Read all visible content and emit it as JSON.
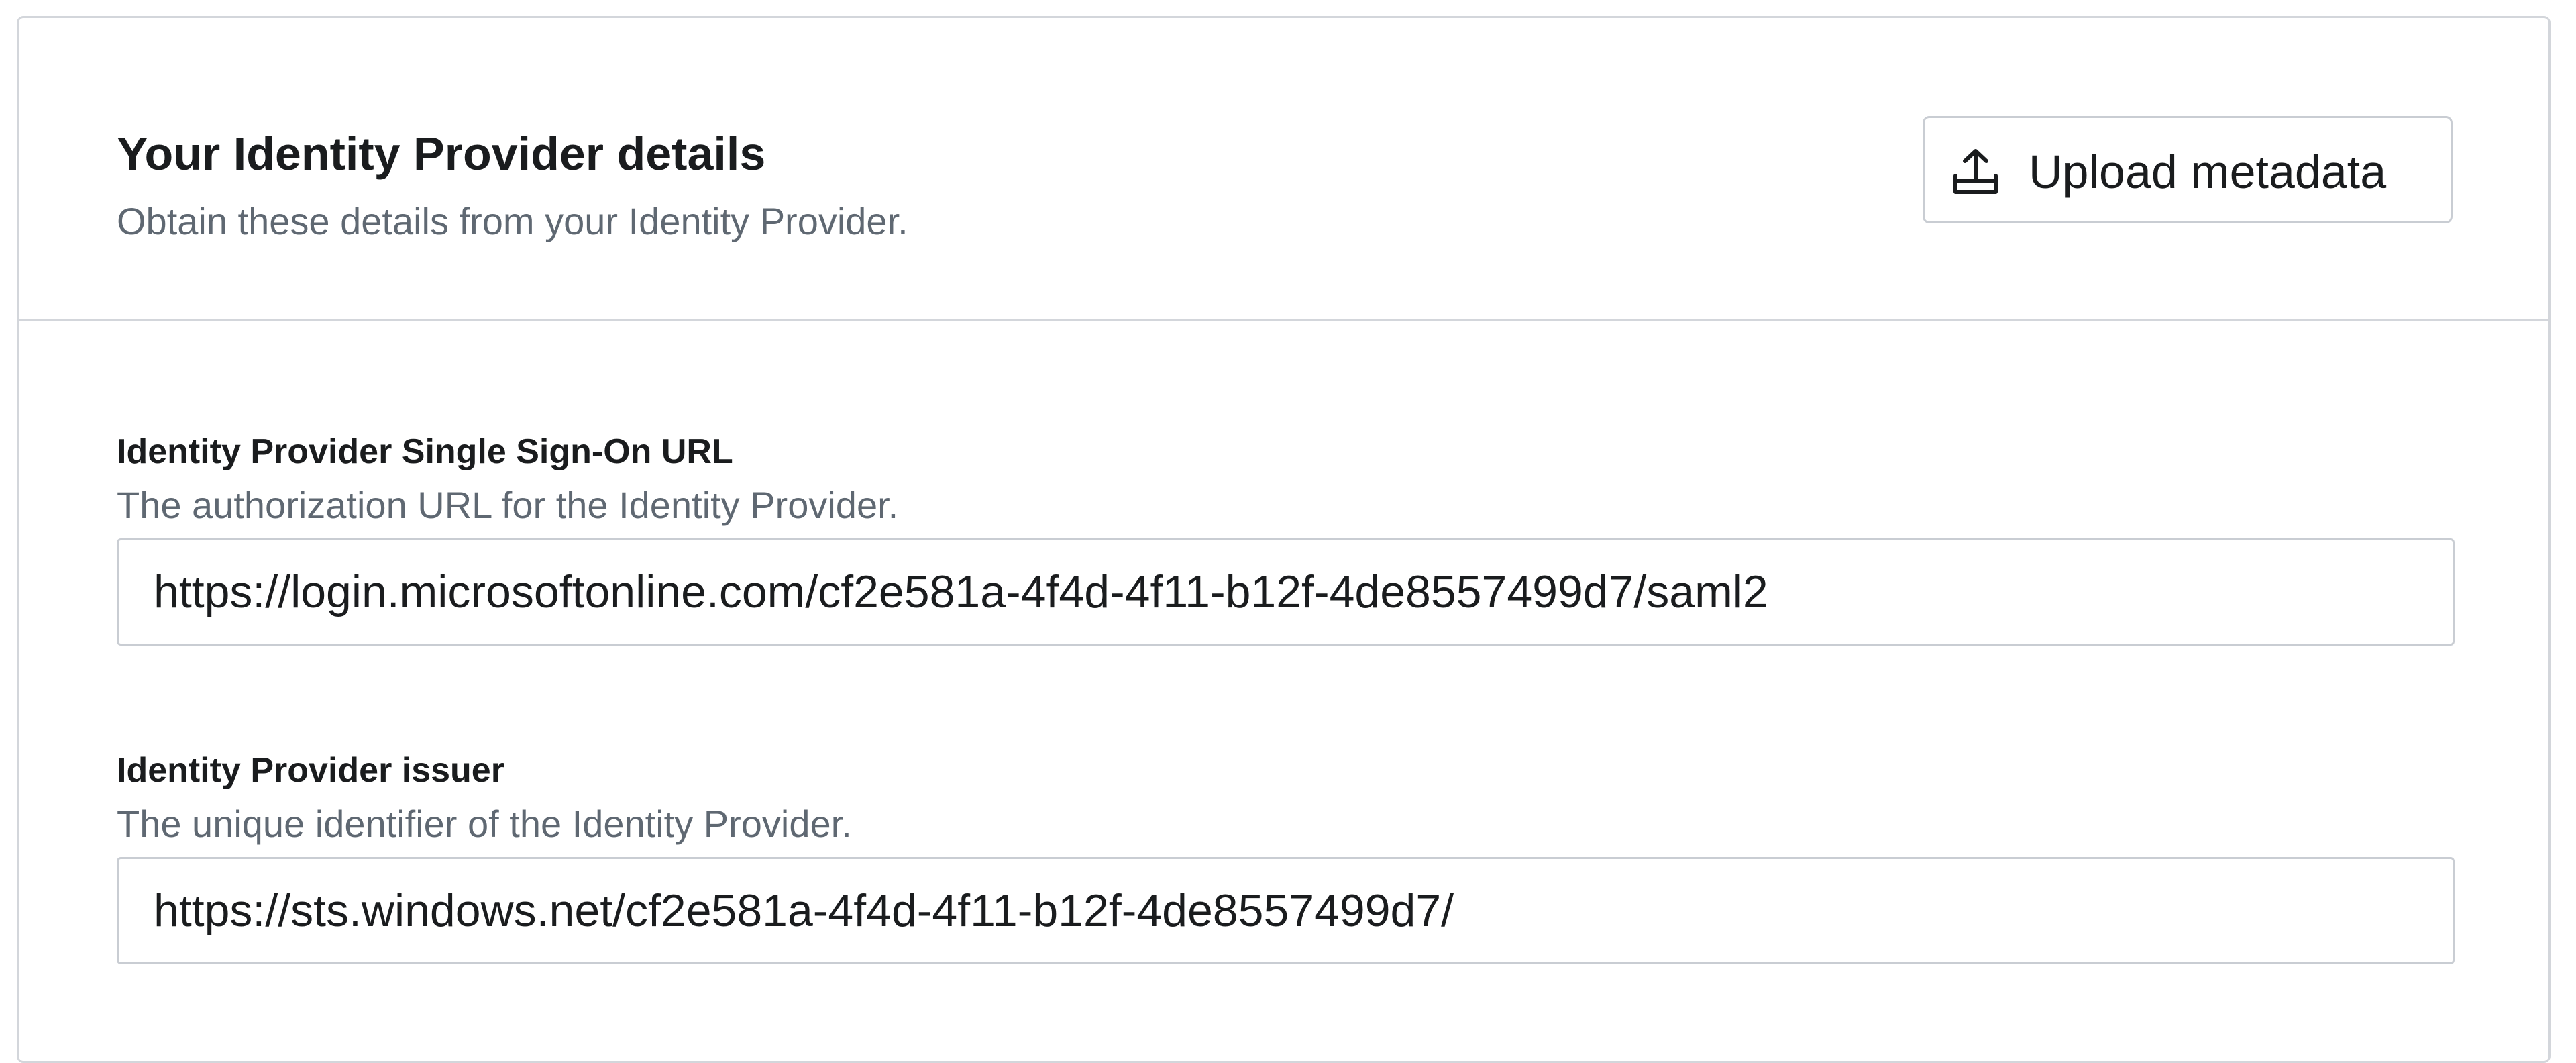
{
  "header": {
    "title": "Your Identity Provider details",
    "subtitle": "Obtain these details from your Identity Provider.",
    "upload_button_label": "Upload metadata",
    "upload_icon": "upload-icon"
  },
  "fields": [
    {
      "label": "Identity Provider Single Sign-On URL",
      "help": "The authorization URL for the Identity Provider.",
      "value": "https://login.microsoftonline.com/cf2e581a-4f4d-4f11-b12f-4de8557499d7/saml2"
    },
    {
      "label": "Identity Provider issuer",
      "help": "The unique identifier of the Identity Provider.",
      "value": "https://sts.windows.net/cf2e581a-4f4d-4f11-b12f-4de8557499d7/"
    }
  ],
  "colors": {
    "border": "#d3d6db",
    "text_primary": "#1a1c1e",
    "text_secondary": "#5f6872"
  }
}
